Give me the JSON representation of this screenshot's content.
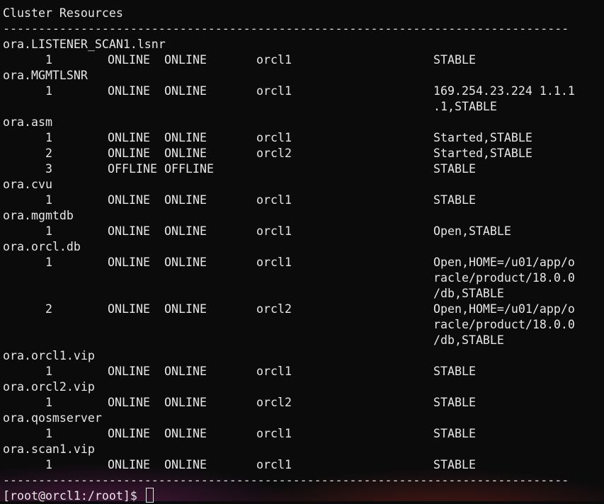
{
  "terminal": {
    "header": "Cluster Resources",
    "separator_top": "--------------------------------------------------------------------------------",
    "separator_bottom": "--------------------------------------------------------------------------------",
    "prompt": "[root@orcl1:/root]$ "
  },
  "lines": [
    {
      "kind": "name",
      "text": "ora.LISTENER_SCAN1.lsnr"
    },
    {
      "kind": "row",
      "num": "1",
      "target": "ONLINE",
      "state": "ONLINE",
      "server": "orcl1",
      "details": "STABLE"
    },
    {
      "kind": "name",
      "text": "ora.MGMTLSNR"
    },
    {
      "kind": "row",
      "num": "1",
      "target": "ONLINE",
      "state": "ONLINE",
      "server": "orcl1",
      "details": "169.254.23.224 1.1.1"
    },
    {
      "kind": "cont",
      "details": ".1,STABLE"
    },
    {
      "kind": "name",
      "text": "ora.asm"
    },
    {
      "kind": "row",
      "num": "1",
      "target": "ONLINE",
      "state": "ONLINE",
      "server": "orcl1",
      "details": "Started,STABLE"
    },
    {
      "kind": "row",
      "num": "2",
      "target": "ONLINE",
      "state": "ONLINE",
      "server": "orcl2",
      "details": "Started,STABLE"
    },
    {
      "kind": "row",
      "num": "3",
      "target": "OFFLINE",
      "state": "OFFLINE",
      "server": "",
      "details": "STABLE"
    },
    {
      "kind": "name",
      "text": "ora.cvu"
    },
    {
      "kind": "row",
      "num": "1",
      "target": "ONLINE",
      "state": "ONLINE",
      "server": "orcl1",
      "details": "STABLE"
    },
    {
      "kind": "name",
      "text": "ora.mgmtdb"
    },
    {
      "kind": "row",
      "num": "1",
      "target": "ONLINE",
      "state": "ONLINE",
      "server": "orcl1",
      "details": "Open,STABLE"
    },
    {
      "kind": "name",
      "text": "ora.orcl.db"
    },
    {
      "kind": "row",
      "num": "1",
      "target": "ONLINE",
      "state": "ONLINE",
      "server": "orcl1",
      "details": "Open,HOME=/u01/app/o"
    },
    {
      "kind": "cont",
      "details": "racle/product/18.0.0"
    },
    {
      "kind": "cont",
      "details": "/db,STABLE"
    },
    {
      "kind": "row",
      "num": "2",
      "target": "ONLINE",
      "state": "ONLINE",
      "server": "orcl2",
      "details": "Open,HOME=/u01/app/o"
    },
    {
      "kind": "cont",
      "details": "racle/product/18.0.0"
    },
    {
      "kind": "cont",
      "details": "/db,STABLE"
    },
    {
      "kind": "name",
      "text": "ora.orcl1.vip"
    },
    {
      "kind": "row",
      "num": "1",
      "target": "ONLINE",
      "state": "ONLINE",
      "server": "orcl1",
      "details": "STABLE"
    },
    {
      "kind": "name",
      "text": "ora.orcl2.vip"
    },
    {
      "kind": "row",
      "num": "1",
      "target": "ONLINE",
      "state": "ONLINE",
      "server": "orcl2",
      "details": "STABLE"
    },
    {
      "kind": "name",
      "text": "ora.qosmserver"
    },
    {
      "kind": "row",
      "num": "1",
      "target": "ONLINE",
      "state": "ONLINE",
      "server": "orcl1",
      "details": "STABLE"
    },
    {
      "kind": "name",
      "text": "ora.scan1.vip"
    },
    {
      "kind": "row",
      "num": "1",
      "target": "ONLINE",
      "state": "ONLINE",
      "server": "orcl1",
      "details": "STABLE"
    }
  ]
}
